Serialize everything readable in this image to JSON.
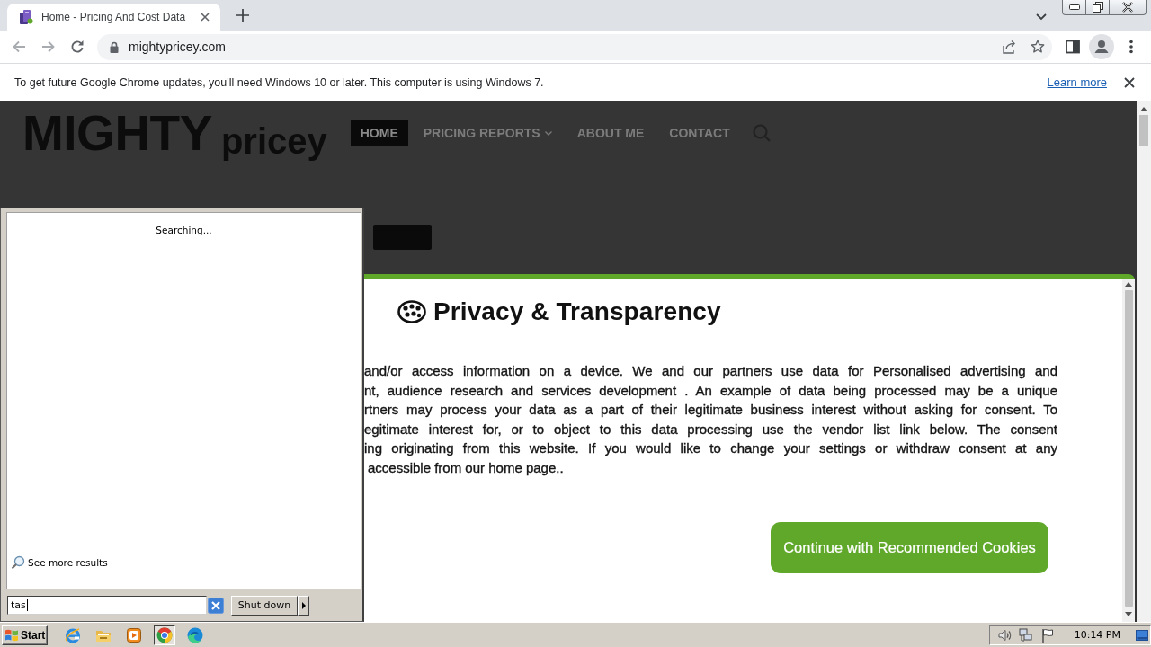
{
  "browser": {
    "tab": {
      "title": "Home - Pricing And Cost Data",
      "selected": true
    },
    "address": "mightypricey.com"
  },
  "infobar": {
    "message": "To get future Google Chrome updates, you'll need Windows 10 or later. This computer is using Windows 7.",
    "link": "Learn more"
  },
  "site": {
    "logo": {
      "main": "MIGHTY",
      "sub": "pricey"
    },
    "nav": [
      {
        "label": "HOME",
        "selected": true,
        "has_menu": false
      },
      {
        "label": "PRICING REPORTS",
        "selected": false,
        "has_menu": true
      },
      {
        "label": "ABOUT ME",
        "selected": false,
        "has_menu": false
      },
      {
        "label": "CONTACT",
        "selected": false,
        "has_menu": false
      }
    ]
  },
  "dialog": {
    "title": "Privacy & Transparency",
    "lines": [
      "and/or access information on a device. We and our partners use data for Personalised advertising and",
      "nt, audience research and services development . An example of data being processed may be a unique",
      "rtners may process your data as a part of their legitimate business interest without asking for consent. To",
      "egitimate interest for, or to object to this data processing use the vendor list link below. The consent",
      "ing originating from this website. If you would like to change your settings or withdraw consent at any",
      "accessible from our home page.."
    ],
    "button": "Continue with Recommended Cookies"
  },
  "start_menu": {
    "status": "Searching...",
    "more_results": "See more results",
    "search_value": "tas",
    "shutdown": "Shut down"
  },
  "taskbar": {
    "start": "Start",
    "apps": [
      {
        "kind": "ie",
        "selected": false
      },
      {
        "kind": "explorer",
        "selected": false
      },
      {
        "kind": "media",
        "selected": false
      },
      {
        "kind": "chrome",
        "selected": true
      },
      {
        "kind": "edge",
        "selected": false
      }
    ],
    "clock": "10:14 PM"
  }
}
